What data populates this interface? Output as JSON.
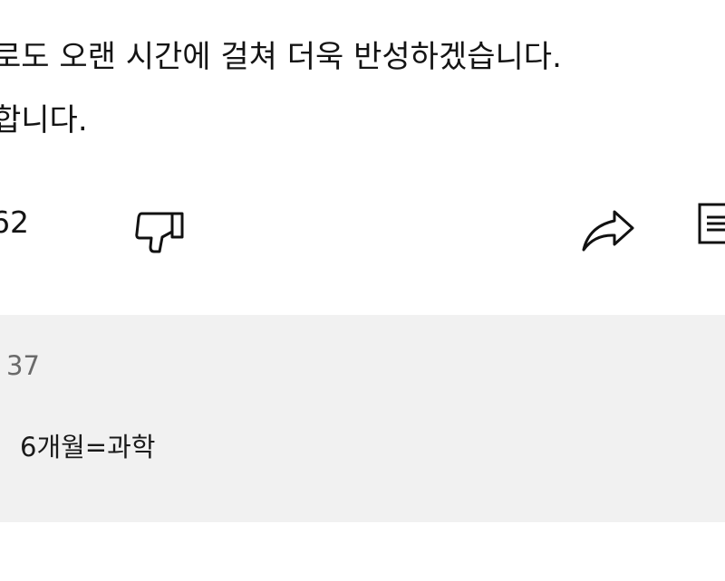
{
  "post": {
    "line_1": "로도 오랜 시간에 걸쳐 더욱 반성하겠습니다.",
    "line_2": "합니다."
  },
  "actions": {
    "like_count": "62",
    "dislike_icon": "thumbs-down-icon",
    "share_icon": "share-arrow-icon",
    "save_icon": "save-to-playlist-icon"
  },
  "replies": {
    "count": "37",
    "preview_text": "6개월=과학"
  }
}
